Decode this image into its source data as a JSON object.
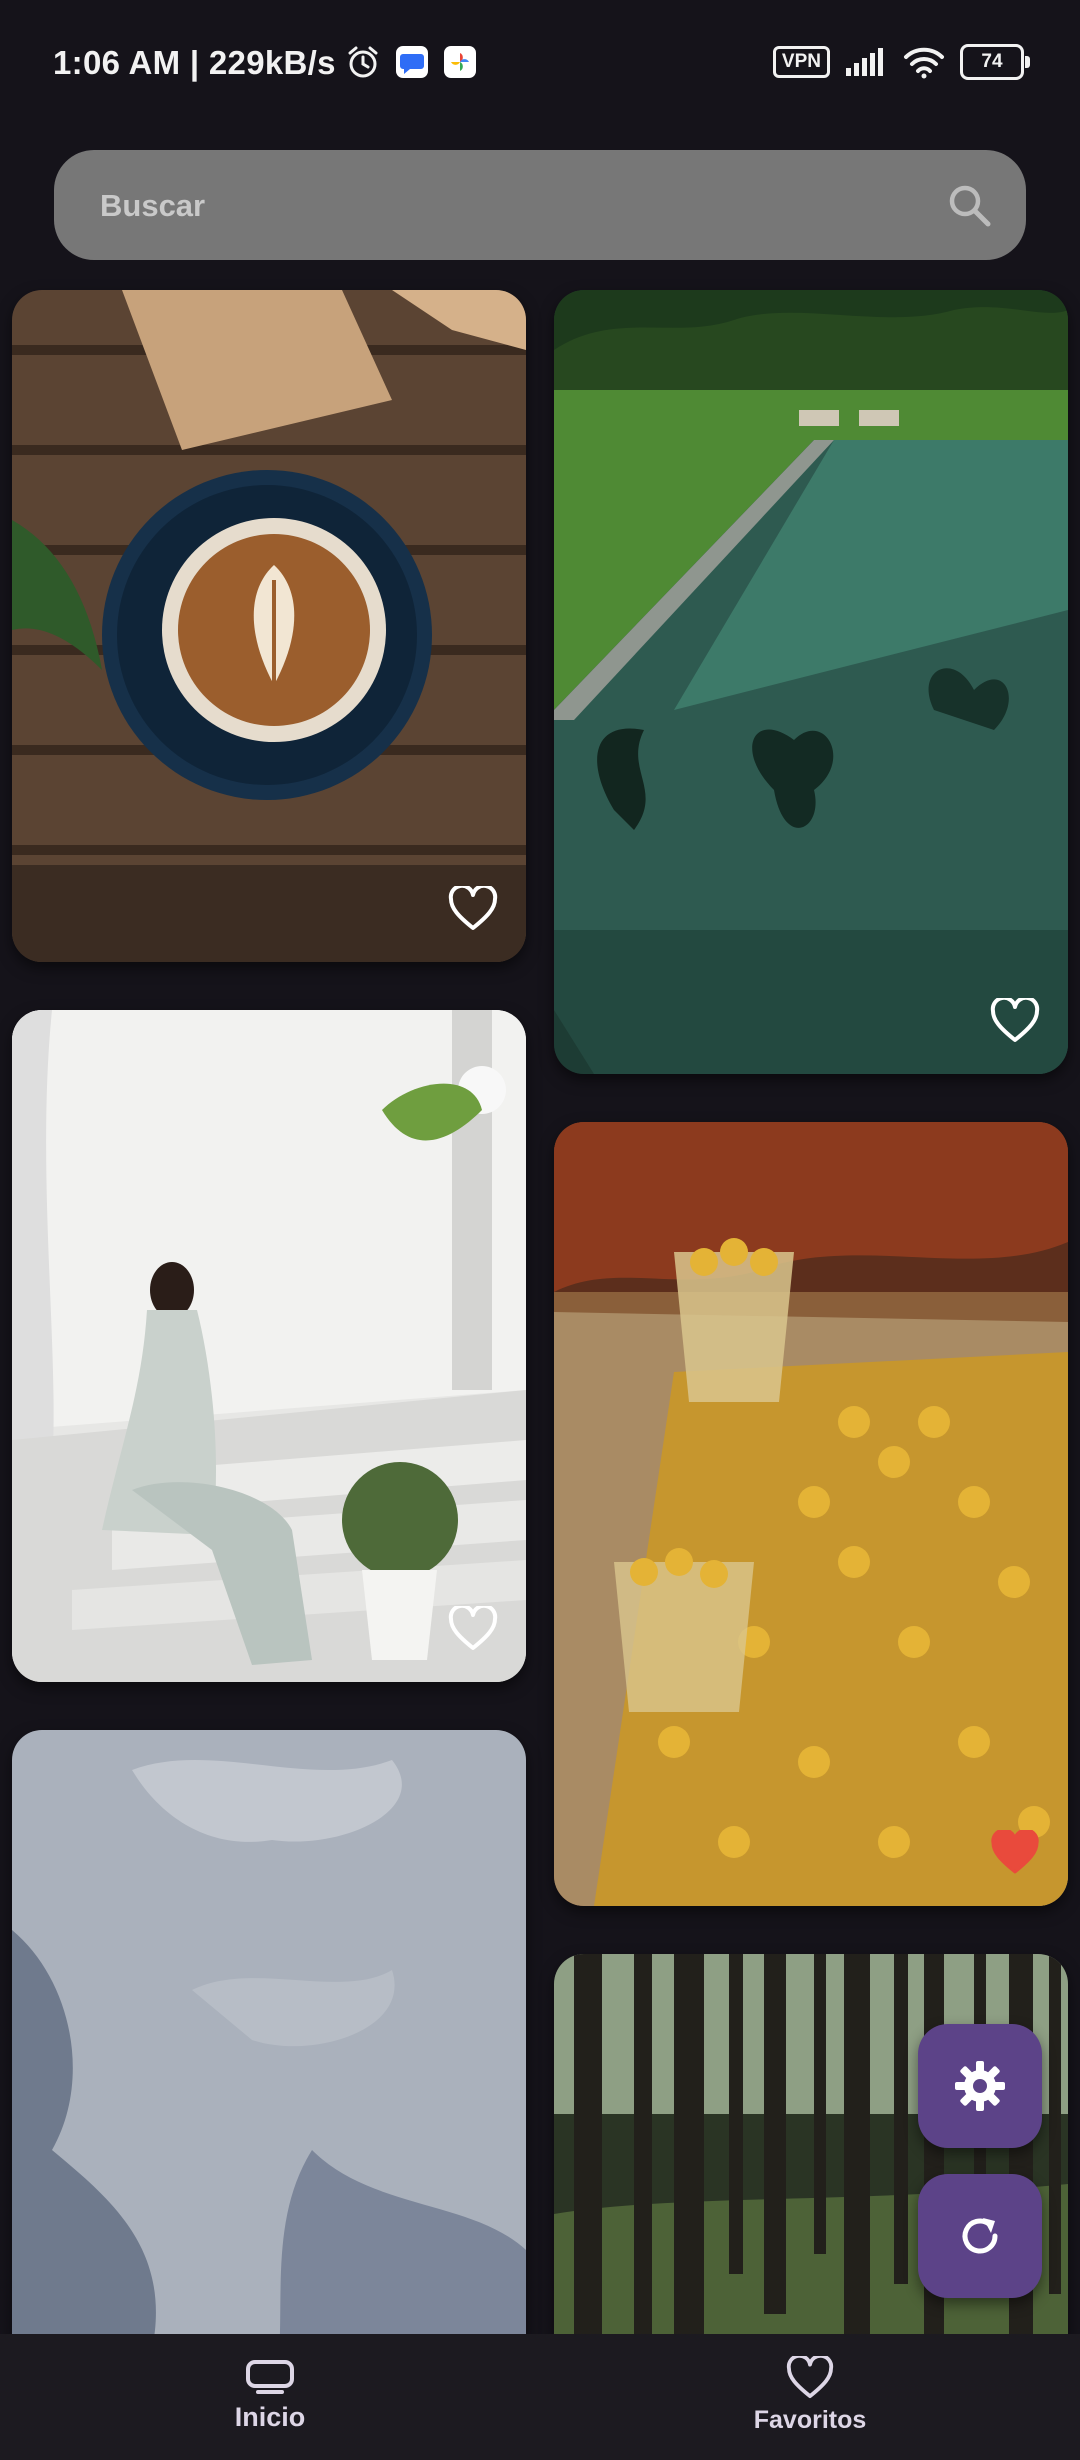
{
  "status_bar": {
    "time_text": "1:06 AM | 229kB/s",
    "vpn": "VPN",
    "battery": "74"
  },
  "search": {
    "placeholder": "Buscar"
  },
  "cards": [
    {
      "subject": "latte art coffee cup on wooden crate",
      "favorite": false
    },
    {
      "subject": "swimming pool reflecting palm trees",
      "favorite": false
    },
    {
      "subject": "woman seated on white steps with plants",
      "favorite": false
    },
    {
      "subject": "yellow peppers in cups at market",
      "favorite": true
    },
    {
      "subject": "grey textured sky wall",
      "favorite": false
    },
    {
      "subject": "pine forest trunks",
      "favorite": false
    }
  ],
  "fabs": {
    "settings_icon": "gear-icon",
    "refresh_icon": "refresh-icon",
    "color": "#5c4388"
  },
  "bottom_nav": {
    "items": [
      {
        "label": "Inicio",
        "icon": "home-icon",
        "selected": true
      },
      {
        "label": "Favoritos",
        "icon": "heart-icon",
        "selected": false
      }
    ]
  },
  "colors": {
    "background": "#15131a",
    "favorite_heart": "#e94a3c",
    "search_bg": "#777777"
  }
}
